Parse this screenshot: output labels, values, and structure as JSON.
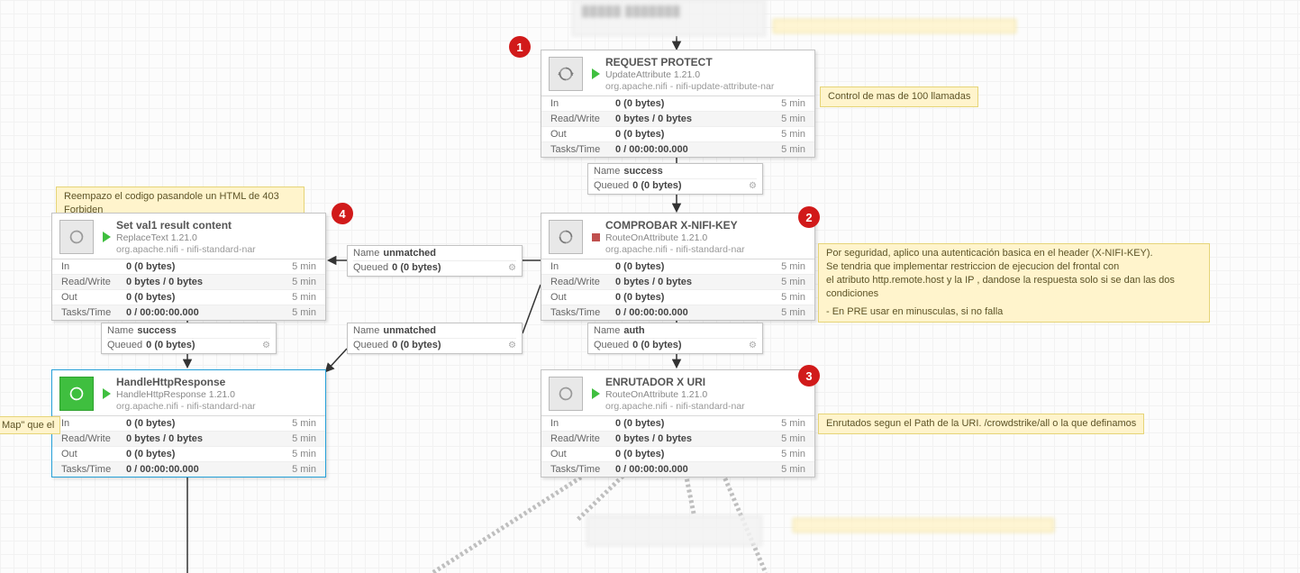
{
  "badges": {
    "b1": "1",
    "b2": "2",
    "b3": "3",
    "b4": "4"
  },
  "processors": {
    "request_protect": {
      "name": "REQUEST PROTECT",
      "type": "UpdateAttribute 1.21.0",
      "bundle": "org.apache.nifi - nifi-update-attribute-nar",
      "running": "play",
      "stats": {
        "in_label": "In",
        "in_val": "0 (0 bytes)",
        "in_time": "5 min",
        "rw_label": "Read/Write",
        "rw_val": "0 bytes / 0 bytes",
        "rw_time": "5 min",
        "out_label": "Out",
        "out_val": "0 (0 bytes)",
        "out_time": "5 min",
        "tt_label": "Tasks/Time",
        "tt_val": "0 / 00:00:00.000",
        "tt_time": "5 min"
      }
    },
    "comprobar": {
      "name": "COMPROBAR X-NIFI-KEY",
      "type": "RouteOnAttribute 1.21.0",
      "bundle": "org.apache.nifi - nifi-standard-nar",
      "running": "stop",
      "stats": {
        "in_label": "In",
        "in_val": "0 (0 bytes)",
        "in_time": "5 min",
        "rw_label": "Read/Write",
        "rw_val": "0 bytes / 0 bytes",
        "rw_time": "5 min",
        "out_label": "Out",
        "out_val": "0 (0 bytes)",
        "out_time": "5 min",
        "tt_label": "Tasks/Time",
        "tt_val": "0 / 00:00:00.000",
        "tt_time": "5 min"
      }
    },
    "enrutador": {
      "name": "ENRUTADOR X URI",
      "type": "RouteOnAttribute 1.21.0",
      "bundle": "org.apache.nifi - nifi-standard-nar",
      "running": "play",
      "stats": {
        "in_label": "In",
        "in_val": "0 (0 bytes)",
        "in_time": "5 min",
        "rw_label": "Read/Write",
        "rw_val": "0 bytes / 0 bytes",
        "rw_time": "5 min",
        "out_label": "Out",
        "out_val": "0 (0 bytes)",
        "out_time": "5 min",
        "tt_label": "Tasks/Time",
        "tt_val": "0 / 00:00:00.000",
        "tt_time": "5 min"
      }
    },
    "setval": {
      "name": "Set val1 result content",
      "type": "ReplaceText 1.21.0",
      "bundle": "org.apache.nifi - nifi-standard-nar",
      "running": "play",
      "stats": {
        "in_label": "In",
        "in_val": "0 (0 bytes)",
        "in_time": "5 min",
        "rw_label": "Read/Write",
        "rw_val": "0 bytes / 0 bytes",
        "rw_time": "5 min",
        "out_label": "Out",
        "out_val": "0 (0 bytes)",
        "out_time": "5 min",
        "tt_label": "Tasks/Time",
        "tt_val": "0 / 00:00:00.000",
        "tt_time": "5 min"
      }
    },
    "handle": {
      "name": "HandleHttpResponse",
      "type": "HandleHttpResponse 1.21.0",
      "bundle": "org.apache.nifi - nifi-standard-nar",
      "running": "play",
      "stats": {
        "in_label": "In",
        "in_val": "0 (0 bytes)",
        "in_time": "5 min",
        "rw_label": "Read/Write",
        "rw_val": "0 bytes / 0 bytes",
        "rw_time": "5 min",
        "out_label": "Out",
        "out_val": "0 (0 bytes)",
        "out_time": "5 min",
        "tt_label": "Tasks/Time",
        "tt_val": "0 / 00:00:00.000",
        "tt_time": "5 min"
      }
    }
  },
  "connections": {
    "success_top": {
      "name_lbl": "Name",
      "name": "success",
      "queued_lbl": "Queued",
      "queued": "0 (0 bytes)"
    },
    "unmatched_mid": {
      "name_lbl": "Name",
      "name": "unmatched",
      "queued_lbl": "Queued",
      "queued": "0 (0 bytes)"
    },
    "auth": {
      "name_lbl": "Name",
      "name": "auth",
      "queued_lbl": "Queued",
      "queued": "0 (0 bytes)"
    },
    "success_left": {
      "name_lbl": "Name",
      "name": "success",
      "queued_lbl": "Queued",
      "queued": "0 (0 bytes)"
    },
    "unmatched_left": {
      "name_lbl": "Name",
      "name": "unmatched",
      "queued_lbl": "Queued",
      "queued": "0 (0 bytes)"
    }
  },
  "notes": {
    "n_100": "Control de mas de 100 llamadas",
    "n_403": "Reempazo el codigo pasandole un HTML de 403 Forbiden",
    "n_sec_l1": "Por seguridad, aplico una autenticación basica en el header (X-NIFI-KEY).",
    "n_sec_l2": "Se tendria que implementar restriccion de ejecucion del frontal con",
    "n_sec_l3": "el atributo http.remote.host y la IP , dandose la respuesta solo si se dan las dos condiciones",
    "n_sec_l4": "- En PRE usar en minusculas, si no falla",
    "n_uri": "Enrutados segun el Path de la URI. /crowdstrike/all o la que definamos",
    "n_map": "Map\" que el"
  },
  "gear_glyph": "⚙"
}
